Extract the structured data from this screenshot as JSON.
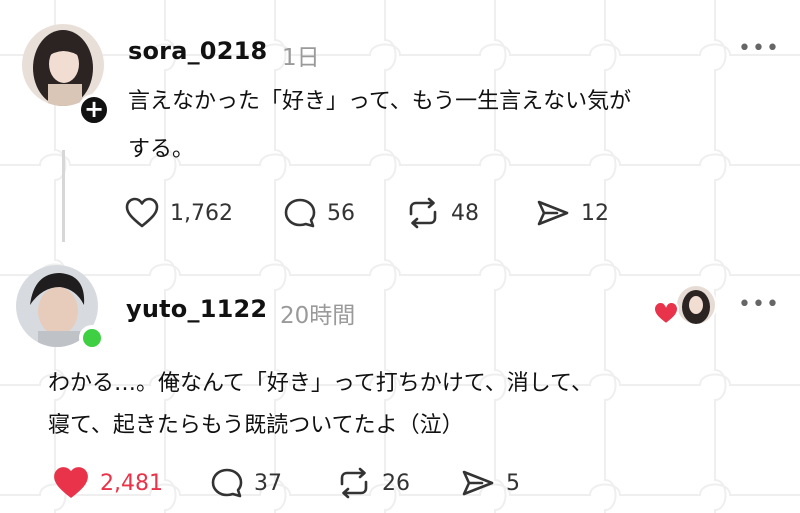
{
  "posts": [
    {
      "username": "sora_0218",
      "time": "1日",
      "text_lines": [
        "言えなかった「好き」って、もう一生言えない気が",
        "する。"
      ],
      "actions": {
        "likes": "1,762",
        "comments": "56",
        "reposts": "48",
        "shares": "12"
      },
      "more_label": "•••"
    },
    {
      "username": "yuto_1122",
      "time": "20時間",
      "text_lines": [
        "わかる…。俺なんて「好き」って打ちかけて、消して、",
        "寝て、起きたらもう既読ついてたよ（泣）"
      ],
      "actions": {
        "likes": "2,481",
        "comments": "37",
        "reposts": "26",
        "shares": "5"
      },
      "more_label": "•••",
      "liked": true
    }
  ],
  "colors": {
    "like_active": "#e8334a",
    "online": "#3ecf43",
    "muted": "#9a9a9a"
  },
  "icons": [
    "plus-icon",
    "heart-icon",
    "comment-icon",
    "repost-icon",
    "share-icon",
    "more-icon"
  ]
}
